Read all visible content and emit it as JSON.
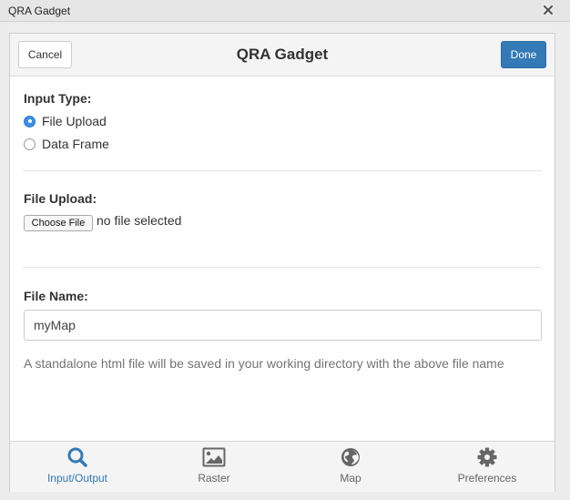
{
  "window": {
    "title": "QRA Gadget",
    "close_icon": "close-icon"
  },
  "header": {
    "cancel_label": "Cancel",
    "title": "QRA Gadget",
    "done_label": "Done"
  },
  "input_type": {
    "label": "Input Type:",
    "options": [
      {
        "label": "File Upload",
        "selected": true
      },
      {
        "label": "Data Frame",
        "selected": false
      }
    ]
  },
  "file_upload": {
    "label": "File Upload:",
    "button_label": "Choose File",
    "status": "no file selected"
  },
  "file_name": {
    "label": "File Name:",
    "value": "myMap",
    "help": "A standalone html file will be saved in your working directory with the above file name"
  },
  "nav": [
    {
      "label": "Input/Output",
      "icon": "search-icon",
      "active": true
    },
    {
      "label": "Raster",
      "icon": "image-icon",
      "active": false
    },
    {
      "label": "Map",
      "icon": "globe-icon",
      "active": false
    },
    {
      "label": "Preferences",
      "icon": "gear-icon",
      "active": false
    }
  ],
  "colors": {
    "primary": "#337ab7",
    "radio_selected": "#3a8ee6",
    "inactive_icon": "#666666"
  }
}
